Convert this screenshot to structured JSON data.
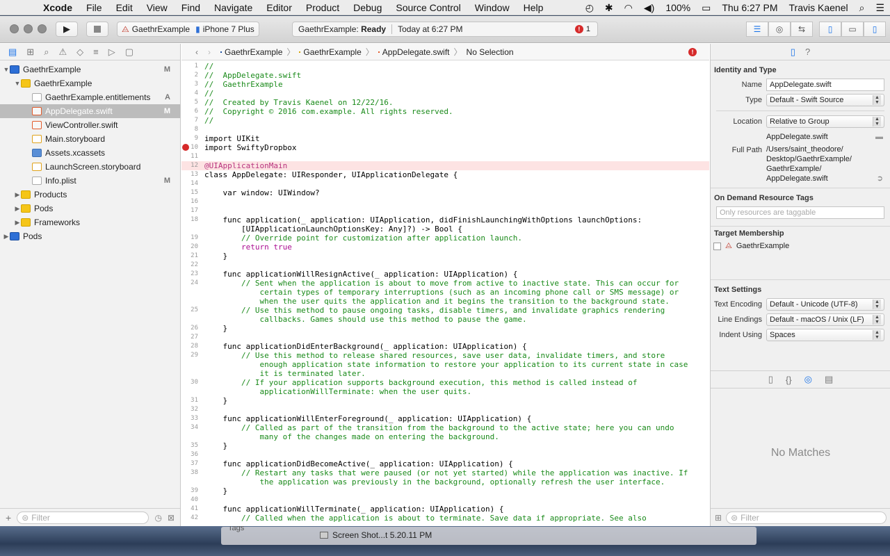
{
  "menubar": {
    "app": "Xcode",
    "items": [
      "File",
      "Edit",
      "View",
      "Find",
      "Navigate",
      "Editor",
      "Product",
      "Debug",
      "Source Control",
      "Window",
      "Help"
    ],
    "battery": "100%",
    "clock": "Thu 6:27 PM",
    "user": "Travis Kaenel"
  },
  "toolbar": {
    "scheme": "GaethrExample",
    "device": "iPhone 7 Plus",
    "status_app": "GaethrExample:",
    "status_state": "Ready",
    "status_time": "Today at 6:27 PM",
    "error_count": "1"
  },
  "navigator": {
    "items": [
      {
        "label": "GaethrExample",
        "badge": "M",
        "indent": 0,
        "kind": "proj",
        "disc": "▼"
      },
      {
        "label": "GaethrExample",
        "badge": "",
        "indent": 1,
        "kind": "folder",
        "disc": "▼"
      },
      {
        "label": "GaethrExample.entitlements",
        "badge": "A",
        "indent": 2,
        "kind": "file",
        "disc": ""
      },
      {
        "label": "AppDelegate.swift",
        "badge": "M",
        "indent": 2,
        "kind": "swift",
        "disc": "",
        "selected": true
      },
      {
        "label": "ViewController.swift",
        "badge": "",
        "indent": 2,
        "kind": "swift",
        "disc": ""
      },
      {
        "label": "Main.storyboard",
        "badge": "",
        "indent": 2,
        "kind": "sb",
        "disc": ""
      },
      {
        "label": "Assets.xcassets",
        "badge": "",
        "indent": 2,
        "kind": "asset",
        "disc": ""
      },
      {
        "label": "LaunchScreen.storyboard",
        "badge": "",
        "indent": 2,
        "kind": "sb",
        "disc": ""
      },
      {
        "label": "Info.plist",
        "badge": "M",
        "indent": 2,
        "kind": "file",
        "disc": ""
      },
      {
        "label": "Products",
        "badge": "",
        "indent": 1,
        "kind": "folder",
        "disc": "▶"
      },
      {
        "label": "Pods",
        "badge": "",
        "indent": 1,
        "kind": "folder",
        "disc": "▶"
      },
      {
        "label": "Frameworks",
        "badge": "",
        "indent": 1,
        "kind": "folder",
        "disc": "▶"
      },
      {
        "label": "Pods",
        "badge": "",
        "indent": 0,
        "kind": "proj",
        "disc": "▶"
      }
    ],
    "filter_placeholder": "Filter"
  },
  "jumpbar": {
    "project": "GaethrExample",
    "group": "GaethrExample",
    "file": "AppDelegate.swift",
    "selection": "No Selection"
  },
  "code": [
    {
      "n": "1",
      "t": "//",
      "c": "cm"
    },
    {
      "n": "2",
      "t": "//  AppDelegate.swift",
      "c": "cm"
    },
    {
      "n": "3",
      "t": "//  GaethrExample",
      "c": "cm"
    },
    {
      "n": "4",
      "t": "//",
      "c": "cm"
    },
    {
      "n": "5",
      "t": "//  Created by Travis Kaenel on 12/22/16.",
      "c": "cm"
    },
    {
      "n": "6",
      "t": "//  Copyright © 2016 com.example. All rights reserved.",
      "c": "cm"
    },
    {
      "n": "7",
      "t": "//",
      "c": "cm"
    },
    {
      "n": "8",
      "t": "",
      "c": ""
    },
    {
      "n": "9",
      "t": "import UIKit",
      "c": ""
    },
    {
      "n": "10",
      "t": "import SwiftyDropbox",
      "c": "",
      "err": true
    },
    {
      "n": "11",
      "t": "",
      "c": ""
    },
    {
      "n": "12",
      "t": "@UIApplicationMain",
      "c": "at",
      "hl": true
    },
    {
      "n": "13",
      "t": "class AppDelegate: UIResponder, UIApplicationDelegate {",
      "c": ""
    },
    {
      "n": "14",
      "t": "",
      "c": ""
    },
    {
      "n": "15",
      "t": "    var window: UIWindow?",
      "c": ""
    },
    {
      "n": "16",
      "t": "",
      "c": ""
    },
    {
      "n": "17",
      "t": "",
      "c": ""
    },
    {
      "n": "18",
      "t": "    func application(_ application: UIApplication, didFinishLaunchingWithOptions launchOptions:\n        [UIApplicationLaunchOptionsKey: Any]?) -> Bool {",
      "c": "",
      "wrap": 2
    },
    {
      "n": "19",
      "t": "        // Override point for customization after application launch.",
      "c": "cm"
    },
    {
      "n": "20",
      "t": "        return true",
      "c": "kw"
    },
    {
      "n": "21",
      "t": "    }",
      "c": ""
    },
    {
      "n": "22",
      "t": "",
      "c": ""
    },
    {
      "n": "23",
      "t": "    func applicationWillResignActive(_ application: UIApplication) {",
      "c": ""
    },
    {
      "n": "24",
      "t": "        // Sent when the application is about to move from active to inactive state. This can occur for\n            certain types of temporary interruptions (such as an incoming phone call or SMS message) or\n            when the user quits the application and it begins the transition to the background state.",
      "c": "cm",
      "wrap": 3
    },
    {
      "n": "25",
      "t": "        // Use this method to pause ongoing tasks, disable timers, and invalidate graphics rendering\n            callbacks. Games should use this method to pause the game.",
      "c": "cm",
      "wrap": 2
    },
    {
      "n": "26",
      "t": "    }",
      "c": ""
    },
    {
      "n": "27",
      "t": "",
      "c": ""
    },
    {
      "n": "28",
      "t": "    func applicationDidEnterBackground(_ application: UIApplication) {",
      "c": ""
    },
    {
      "n": "29",
      "t": "        // Use this method to release shared resources, save user data, invalidate timers, and store\n            enough application state information to restore your application to its current state in case\n            it is terminated later.",
      "c": "cm",
      "wrap": 3
    },
    {
      "n": "30",
      "t": "        // If your application supports background execution, this method is called instead of\n            applicationWillTerminate: when the user quits.",
      "c": "cm",
      "wrap": 2
    },
    {
      "n": "31",
      "t": "    }",
      "c": ""
    },
    {
      "n": "32",
      "t": "",
      "c": ""
    },
    {
      "n": "33",
      "t": "    func applicationWillEnterForeground(_ application: UIApplication) {",
      "c": ""
    },
    {
      "n": "34",
      "t": "        // Called as part of the transition from the background to the active state; here you can undo\n            many of the changes made on entering the background.",
      "c": "cm",
      "wrap": 2
    },
    {
      "n": "35",
      "t": "    }",
      "c": ""
    },
    {
      "n": "36",
      "t": "",
      "c": ""
    },
    {
      "n": "37",
      "t": "    func applicationDidBecomeActive(_ application: UIApplication) {",
      "c": ""
    },
    {
      "n": "38",
      "t": "        // Restart any tasks that were paused (or not yet started) while the application was inactive. If\n            the application was previously in the background, optionally refresh the user interface.",
      "c": "cm",
      "wrap": 2
    },
    {
      "n": "39",
      "t": "    }",
      "c": ""
    },
    {
      "n": "40",
      "t": "",
      "c": ""
    },
    {
      "n": "41",
      "t": "    func applicationWillTerminate(_ application: UIApplication) {",
      "c": ""
    },
    {
      "n": "42",
      "t": "        // Called when the application is about to terminate. Save data if appropriate. See also",
      "c": "cm"
    }
  ],
  "inspector": {
    "identity_title": "Identity and Type",
    "name_label": "Name",
    "name_value": "AppDelegate.swift",
    "type_label": "Type",
    "type_value": "Default - Swift Source",
    "location_label": "Location",
    "location_value": "Relative to Group",
    "location_file": "AppDelegate.swift",
    "fullpath_label": "Full Path",
    "fullpath_value": "/Users/saint_theodore/\nDesktop/GaethrExample/\nGaethrExample/\nAppDelegate.swift",
    "odr_title": "On Demand Resource Tags",
    "odr_placeholder": "Only resources are taggable",
    "target_title": "Target Membership",
    "target_name": "GaethrExample",
    "text_title": "Text Settings",
    "encoding_label": "Text Encoding",
    "encoding_value": "Default - Unicode (UTF-8)",
    "endings_label": "Line Endings",
    "endings_value": "Default - macOS / Unix (LF)",
    "indent_label": "Indent Using",
    "indent_value": "Spaces",
    "no_matches": "No Matches",
    "filter_placeholder": "Filter"
  },
  "dock": {
    "item": "Screen Shot...t 5.20.11 PM",
    "tags": "Tags"
  }
}
